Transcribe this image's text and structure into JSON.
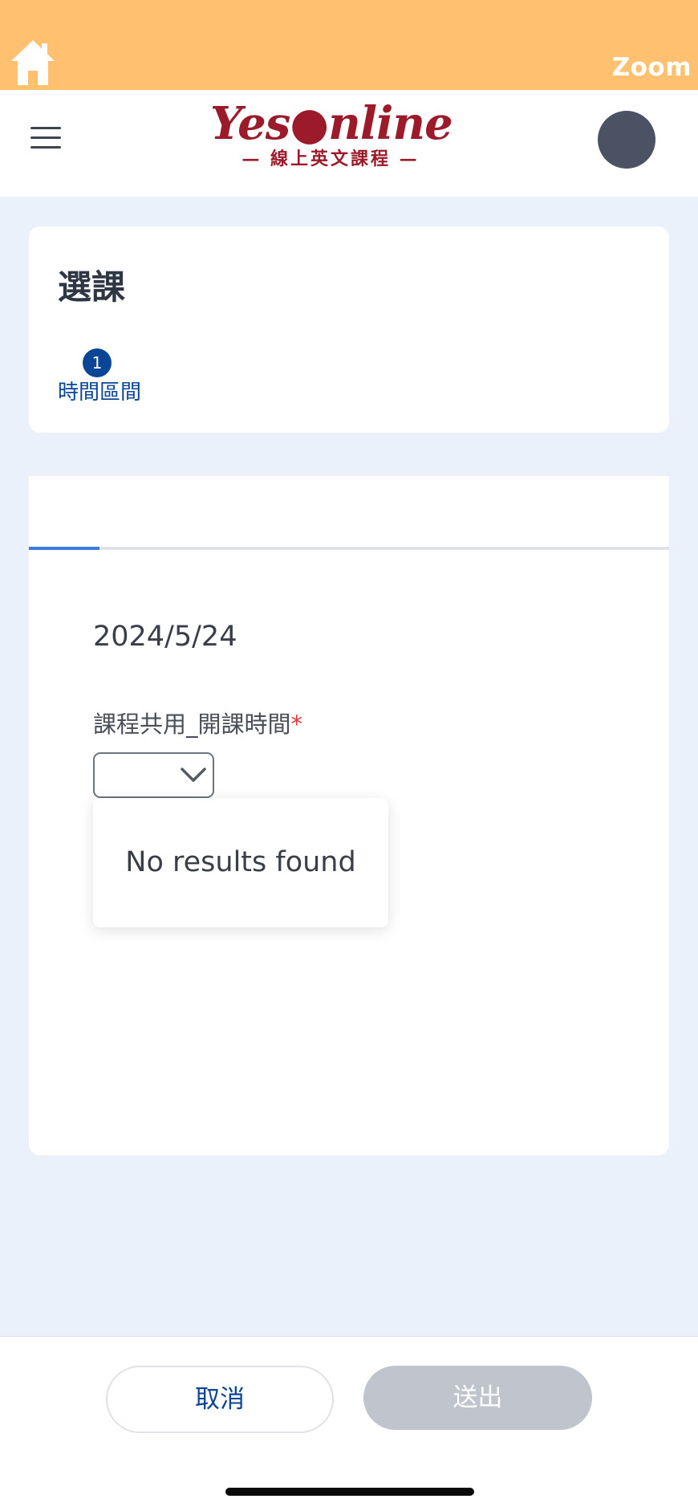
{
  "topbar": {
    "background": "#ffc170",
    "zoom_label": "Zoom",
    "home_icon": "home-icon"
  },
  "header": {
    "menu_icon": "hamburger-menu-icon",
    "logo_main": "Yes●nline",
    "logo_sub": "— 線上英文課程 —",
    "logo_color": "#9b1b2a"
  },
  "page": {
    "title": "選課",
    "steps": [
      {
        "number": "1",
        "label": "時間區間"
      }
    ]
  },
  "form": {
    "progress_fraction": 0.11,
    "date": "2024/5/24",
    "field_label": "課程共用_開課時間",
    "required_mark": "*",
    "select_value": "",
    "dropdown_message": "No results found"
  },
  "footer": {
    "cancel_label": "取消",
    "submit_label": "送出"
  },
  "colors": {
    "accent": "#0b4596",
    "progress": "#3a7be0",
    "required": "#e03a3a",
    "disabled_button": "#bfc4cd",
    "page_background": "#ebf1fb"
  }
}
